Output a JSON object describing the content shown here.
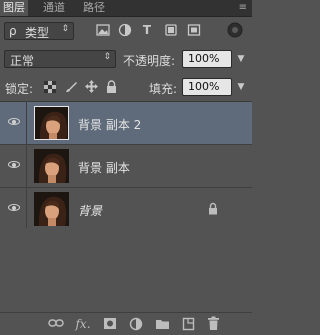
{
  "tabs": [
    {
      "label": "图层",
      "active": true
    },
    {
      "label": "通道",
      "active": false
    },
    {
      "label": "路径",
      "active": false
    }
  ],
  "filter": {
    "search_glyph": "ρ",
    "kind_label": "类型",
    "icons": [
      "image-filter-icon",
      "adjustment-filter-icon",
      "type-filter-icon",
      "shape-filter-icon",
      "smart-object-filter-icon",
      "filter-toggle-icon"
    ]
  },
  "blend": {
    "mode": "正常",
    "opacity_label": "不透明度:",
    "opacity_value": "100%"
  },
  "lock": {
    "label": "锁定:",
    "fill_label": "填充:",
    "fill_value": "100%"
  },
  "layers": [
    {
      "name": "背景 副本 2",
      "selected": true,
      "locked": false
    },
    {
      "name": "背景 副本",
      "selected": false,
      "locked": false
    },
    {
      "name": "背景",
      "selected": false,
      "locked": true
    }
  ],
  "bottom_icons": [
    "link-layers-icon",
    "fx-icon",
    "add-mask-icon",
    "adjustment-layer-icon",
    "new-group-icon",
    "new-layer-icon",
    "trash-icon"
  ],
  "bottom_fx_label": "fx.",
  "colors": {
    "panel": "#535353",
    "selected_row": "#5f6b7a",
    "tabbar": "#323232"
  }
}
